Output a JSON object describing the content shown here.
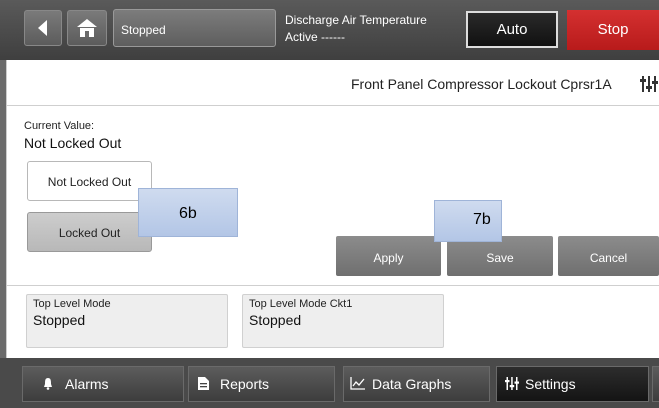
{
  "header": {
    "status": "Stopped",
    "dat_title": "Discharge Air Temperature",
    "dat_value": "Active ------",
    "auto_label": "Auto",
    "stop_label": "Stop",
    "back_icon": "back-arrow-icon",
    "home_icon": "home-icon"
  },
  "panel": {
    "title": "Front Panel Compressor Lockout Cprsr1A",
    "title_icon": "settings-sliders-icon",
    "current_value_label": "Current Value:",
    "current_value": "Not Locked Out",
    "options": [
      "Not Locked Out",
      "Locked Out"
    ],
    "selected_option": "Locked Out",
    "actions": {
      "apply": "Apply",
      "save": "Save",
      "cancel": "Cancel"
    }
  },
  "callouts": {
    "c6": "6b",
    "c7": "7b",
    "color": "#c3d3ee"
  },
  "modes": [
    {
      "label": "Top Level Mode",
      "value": "Stopped"
    },
    {
      "label": "Top Level Mode Ckt1",
      "value": "Stopped"
    }
  ],
  "nav": {
    "items": [
      {
        "label": "Alarms",
        "icon": "bell-icon"
      },
      {
        "label": "Reports",
        "icon": "report-icon"
      },
      {
        "label": "Data Graphs",
        "icon": "chart-icon"
      },
      {
        "label": "Settings",
        "icon": "settings-sliders-icon"
      }
    ],
    "active": "Settings"
  },
  "colors": {
    "stop": "#c62828",
    "active_tab": "#1e1e1e",
    "bar": "#4a4a4a"
  }
}
